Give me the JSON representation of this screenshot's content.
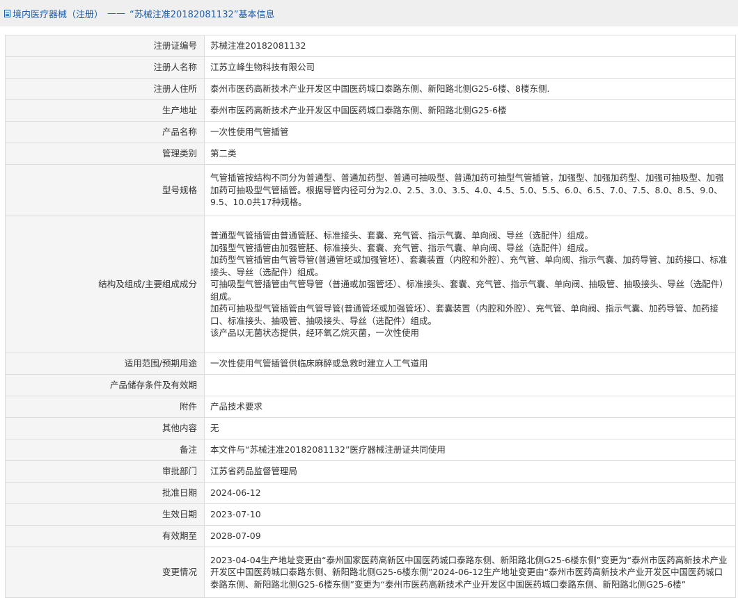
{
  "header": {
    "category": "境内医疗器械（注册）",
    "separator": "——",
    "title": "“苏械注准20182081132”基本信息"
  },
  "rows": [
    {
      "label": "注册证编号",
      "value": [
        "苏械注准20182081132"
      ]
    },
    {
      "label": "注册人名称",
      "value": [
        "江苏立峰生物科技有限公司"
      ]
    },
    {
      "label": "注册人住所",
      "value": [
        "泰州市医药高新技术产业开发区中国医药城口泰路东侧、新阳路北侧G25-6楼、8楼东侧."
      ]
    },
    {
      "label": "生产地址",
      "value": [
        "泰州市医药高新技术产业开发区中国医药城口泰路东侧、新阳路北侧G25-6楼"
      ]
    },
    {
      "label": "产品名称",
      "value": [
        "一次性使用气管插管"
      ]
    },
    {
      "label": "管理类别",
      "value": [
        "第二类"
      ]
    },
    {
      "label": "型号规格",
      "value": [
        "气管插管按结构不同分为普通型、普通加药型、普通可抽吸型、普通加药可抽型气管插管，加强型、加强加药型、加强可抽吸型、加强加药可抽吸型气管插管。根据导管内径可分为2.0、2.5、3.0、3.5、4.0、4.5、5.0、5.5、6.0、6.5、7.0、7.5、8.0、8.5、9.0、9.5、10.0共17种规格。"
      ]
    },
    {
      "label": "结构及组成/主要组成成分",
      "value": [
        "普通型气管插管由普通管胚、标准接头、套囊、充气管、指示气囊、单向阀、导丝（选配件）组成。",
        "加强型气管插管由加强管胚、标准接头、套囊、充气管、指示气囊、单向阀、导丝（选配件）组成。",
        "加药型气管插管由气管导管(普通管坯或加强管坯）、套囊装置（内腔和外腔）、充气管、单向阀、指示气囊、加药导管、加药接口、标准接头、导丝（选配件）组成。",
        "可抽吸型气管插管由气管导管（普通或加强管坯）、标准接头、套囊、充气管、指示气囊、单向阀、抽吸管、抽吸接头、导丝（选配件）组成。",
        "加药可抽吸型气管插管由气管导管(普通管坯或加强管坯）、套囊装置（内腔和外腔）、充气管、单向阀、指示气囊、加药导管、加药接口、标准接头、抽吸管、抽吸接头、导丝（选配件）组成。",
        "该产品以无菌状态提供，经环氧乙烷灭菌，一次性使用"
      ]
    },
    {
      "label": "适用范围/预期用途",
      "value": [
        "一次性使用气管插管供临床麻醉或急救时建立人工气道用"
      ]
    },
    {
      "label": "产品储存条件及有效期",
      "value": [
        ""
      ]
    },
    {
      "label": "附件",
      "value": [
        "产品技术要求"
      ]
    },
    {
      "label": "其他内容",
      "value": [
        "无"
      ]
    },
    {
      "label": "备注",
      "value": [
        "本文件与“苏械注准20182081132”医疗器械注册证共同使用"
      ]
    },
    {
      "label": "审批部门",
      "value": [
        "江苏省药品监督管理局"
      ]
    },
    {
      "label": "批准日期",
      "value": [
        "2024-06-12"
      ]
    },
    {
      "label": "生效日期",
      "value": [
        "2023-07-10"
      ]
    },
    {
      "label": "有效期至",
      "value": [
        "2028-07-09"
      ]
    },
    {
      "label": "变更情况",
      "value": [
        "2023-04-04生产地址变更由“泰州国家医药高新区中国医药城口泰路东侧、新阳路北侧G25-6楼东侧”变更为“泰州市医药高新技术产业开发区中国医药城口泰路东侧、新阳路北侧G25-6楼东侧”2024-06-12生产地址变更由“泰州市医药高新技术产业开发区中国医药城口泰路东侧、新阳路北侧G25-6楼东侧”变更为“泰州市医药高新技术产业开发区中国医药城口泰路东侧、新阳路北侧G25-6楼”"
      ]
    }
  ]
}
